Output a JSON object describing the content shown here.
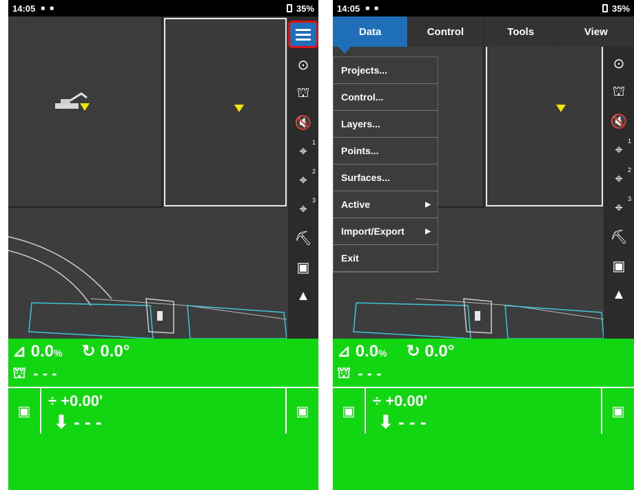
{
  "status": {
    "time": "14:05",
    "battery": "35%"
  },
  "left": {
    "readouts": {
      "cross_slope": "0.0",
      "cross_slope_unit": "%",
      "rotation": "0.0°",
      "bucket_value": "- - -"
    },
    "bottom": {
      "elevation": "+0.00'",
      "cut_fill": "- - -"
    }
  },
  "right": {
    "tabs": [
      {
        "label": "Data"
      },
      {
        "label": "Control"
      },
      {
        "label": "Tools"
      },
      {
        "label": "View"
      }
    ],
    "menu": [
      {
        "label": "Projects..."
      },
      {
        "label": "Control..."
      },
      {
        "label": "Layers..."
      },
      {
        "label": "Points..."
      },
      {
        "label": "Surfaces..."
      },
      {
        "label": "Active"
      },
      {
        "label": "Import/Export"
      },
      {
        "label": "Exit"
      }
    ],
    "readouts": {
      "cross_slope": "0.0",
      "cross_slope_unit": "%",
      "rotation": "0.0°",
      "bucket_value": "- - -"
    },
    "bottom": {
      "elevation": "+0.00'",
      "cut_fill": "- - -"
    }
  },
  "icons": {
    "menu": "hamburger-menu-icon",
    "next": "chevron-right-circle-icon",
    "bucket": "bucket-icon",
    "mute": "speaker-mute-icon",
    "location1": "location-pin-icon",
    "location2": "location-pin-icon",
    "location3": "location-pin-icon",
    "excavator_bucket": "excavator-bucket-icon",
    "total_station": "total-station-icon",
    "total_station_up": "total-station-up-icon"
  },
  "colors": {
    "green_panel": "#11d611",
    "blue_bar": "#1e6fb8",
    "highlight": "#e01010",
    "marker": "#f0e600"
  }
}
